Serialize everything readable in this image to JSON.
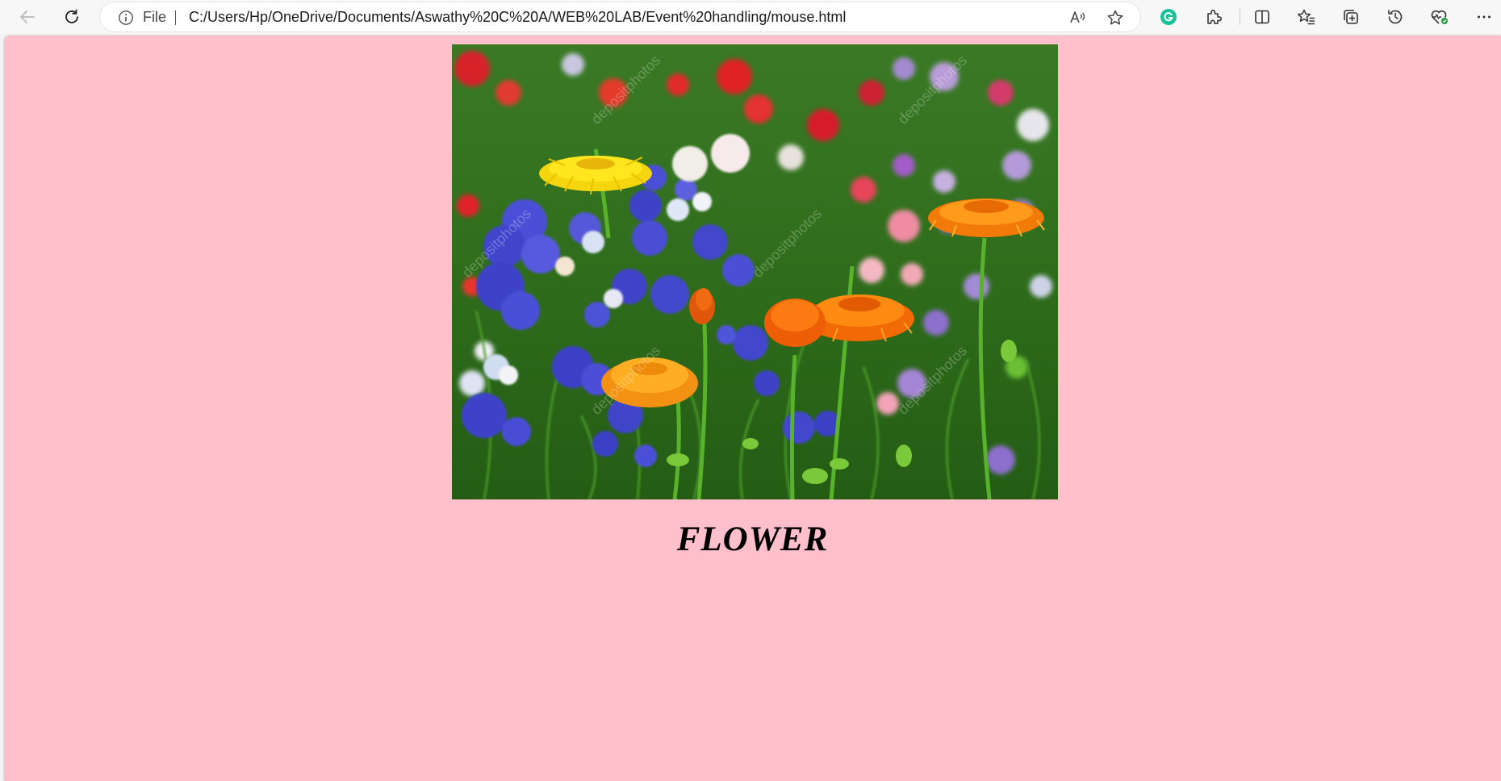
{
  "browser": {
    "address_scheme_label": "File",
    "url": "C:/Users/Hp/OneDrive/Documents/Aswathy%20C%20A/WEB%20LAB/Event%20handling/mouse.html",
    "icons": {
      "back": "back-arrow-icon",
      "reload": "reload-icon",
      "site_info": "info-icon",
      "read_aloud": "read-aloud-icon",
      "favorite": "star-icon",
      "grammarly": "grammarly-icon",
      "extensions": "extensions-icon",
      "split_screen": "split-screen-icon",
      "favorites": "favorites-icon",
      "collections": "collections-icon",
      "history": "history-icon",
      "browser_essentials": "heart-pulse-icon",
      "menu": "more-icon"
    }
  },
  "page": {
    "background_color": "#ffc0cb",
    "image_alt": "flower",
    "caption": "FLOWER"
  }
}
